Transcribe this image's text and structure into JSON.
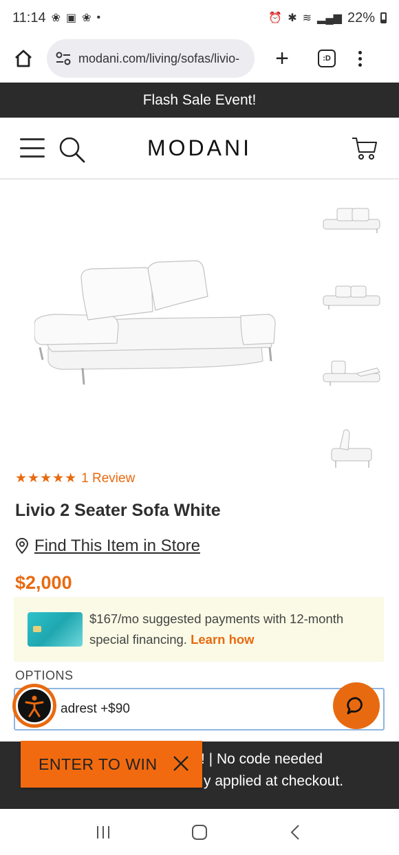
{
  "status_bar": {
    "time": "11:14",
    "battery": "22%"
  },
  "browser": {
    "url": "modani.com/living/sofas/livio-",
    "tabs_label": ":D"
  },
  "flash_banner": "Flash Sale Event!",
  "header": {
    "logo": "MODANI"
  },
  "product": {
    "stars": "★★★★★",
    "reviews": "1 Review",
    "title": "Livio 2 Seater Sofa White",
    "find_store": "Find This Item in Store",
    "price": "$2,000",
    "finance_text": "$167/mo suggested payments with 12-month special financing.",
    "learn_how": "Learn how",
    "options_label": "OPTIONS",
    "option_value": "adrest +$90"
  },
  "promo": {
    "line1": "! | No code needed",
    "line2": "y applied at checkout.",
    "enter_to_win": "ENTER TO WIN"
  },
  "colors": {
    "accent": "#e86a10",
    "dark_bar": "#2b2b2b",
    "finance_bg": "#fafae6"
  }
}
